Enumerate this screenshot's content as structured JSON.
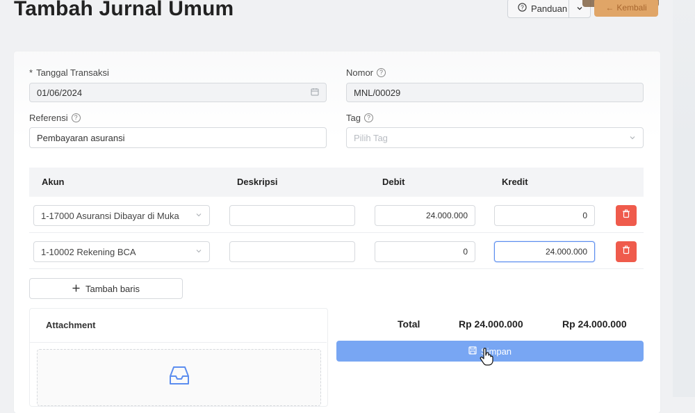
{
  "page": {
    "title": "Tambah Jurnal Umum"
  },
  "header": {
    "guide_label": "Panduan",
    "back_label": "Kembali"
  },
  "form": {
    "date": {
      "label": "Tanggal Transaksi",
      "required_mark": "*",
      "value": "01/06/2024"
    },
    "number": {
      "label": "Nomor",
      "value": "MNL/00029"
    },
    "reference": {
      "label": "Referensi",
      "value": "Pembayaran asuransi"
    },
    "tag": {
      "label": "Tag",
      "placeholder": "Pilih Tag"
    }
  },
  "table": {
    "columns": [
      "Akun",
      "Deskripsi",
      "Debit",
      "Kredit"
    ],
    "rows": [
      {
        "account": "1-17000 Asuransi Dibayar di Muka",
        "description": "",
        "debit": "24.000.000",
        "credit": "0"
      },
      {
        "account": "1-10002 Rekening BCA",
        "description": "",
        "debit": "0",
        "credit": "24.000.000"
      }
    ],
    "add_row_label": "Tambah baris"
  },
  "attachment": {
    "title": "Attachment"
  },
  "totals": {
    "label": "Total",
    "debit": "Rp 24.000.000",
    "credit": "Rp 24.000.000"
  },
  "actions": {
    "save_label": "Simpan"
  },
  "colors": {
    "primary": "#78a6f3",
    "danger": "#ef5b4c",
    "warning": "#e0a567"
  }
}
